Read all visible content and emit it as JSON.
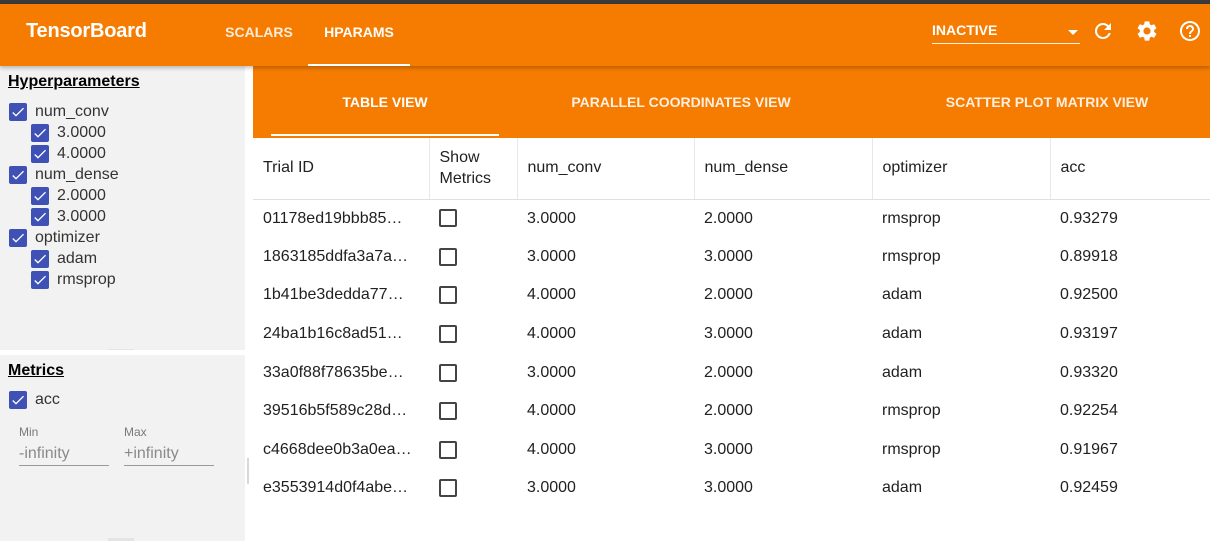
{
  "header": {
    "brand": "TensorBoard",
    "tabs": [
      {
        "label": "SCALARS",
        "active": false
      },
      {
        "label": "HPARAMS",
        "active": true
      }
    ],
    "run_select": {
      "value": "INACTIVE"
    },
    "icons": [
      "refresh-icon",
      "gear-icon",
      "help-icon"
    ]
  },
  "sidebar": {
    "hyperparameters": {
      "title": "Hyperparameters",
      "items": [
        {
          "label": "num_conv",
          "checked": true,
          "values": [
            {
              "label": "3.0000",
              "checked": true
            },
            {
              "label": "4.0000",
              "checked": true
            }
          ]
        },
        {
          "label": "num_dense",
          "checked": true,
          "values": [
            {
              "label": "2.0000",
              "checked": true
            },
            {
              "label": "3.0000",
              "checked": true
            }
          ]
        },
        {
          "label": "optimizer",
          "checked": true,
          "values": [
            {
              "label": "adam",
              "checked": true
            },
            {
              "label": "rmsprop",
              "checked": true
            }
          ]
        }
      ]
    },
    "metrics": {
      "title": "Metrics",
      "items": [
        {
          "label": "acc",
          "checked": true
        }
      ],
      "min": {
        "label": "Min",
        "placeholder": "-infinity"
      },
      "max": {
        "label": "Max",
        "placeholder": "+infinity"
      }
    }
  },
  "main": {
    "view_tabs": [
      {
        "label": "TABLE VIEW",
        "active": true
      },
      {
        "label": "PARALLEL COORDINATES VIEW",
        "active": false
      },
      {
        "label": "SCATTER PLOT MATRIX VIEW",
        "active": false
      }
    ],
    "table": {
      "columns": [
        "Trial ID",
        "Show Metrics",
        "num_conv",
        "num_dense",
        "optimizer",
        "acc"
      ],
      "rows": [
        {
          "trial_id": "01178ed19bbb85…",
          "num_conv": "3.0000",
          "num_dense": "2.0000",
          "optimizer": "rmsprop",
          "acc": "0.93279"
        },
        {
          "trial_id": "1863185ddfa3a7a…",
          "num_conv": "3.0000",
          "num_dense": "3.0000",
          "optimizer": "rmsprop",
          "acc": "0.89918"
        },
        {
          "trial_id": "1b41be3dedda77…",
          "num_conv": "4.0000",
          "num_dense": "2.0000",
          "optimizer": "adam",
          "acc": "0.92500"
        },
        {
          "trial_id": "24ba1b16c8ad51…",
          "num_conv": "4.0000",
          "num_dense": "3.0000",
          "optimizer": "adam",
          "acc": "0.93197"
        },
        {
          "trial_id": "33a0f88f78635be…",
          "num_conv": "3.0000",
          "num_dense": "2.0000",
          "optimizer": "adam",
          "acc": "0.93320"
        },
        {
          "trial_id": "39516b5f589c28d…",
          "num_conv": "4.0000",
          "num_dense": "2.0000",
          "optimizer": "rmsprop",
          "acc": "0.92254"
        },
        {
          "trial_id": "c4668dee0b3a0ea…",
          "num_conv": "4.0000",
          "num_dense": "3.0000",
          "optimizer": "rmsprop",
          "acc": "0.91967"
        },
        {
          "trial_id": "e3553914d0f4abe…",
          "num_conv": "3.0000",
          "num_dense": "3.0000",
          "optimizer": "adam",
          "acc": "0.92459"
        }
      ]
    }
  },
  "colors": {
    "accent": "#f57c00",
    "checkbox": "#3f51b5"
  }
}
